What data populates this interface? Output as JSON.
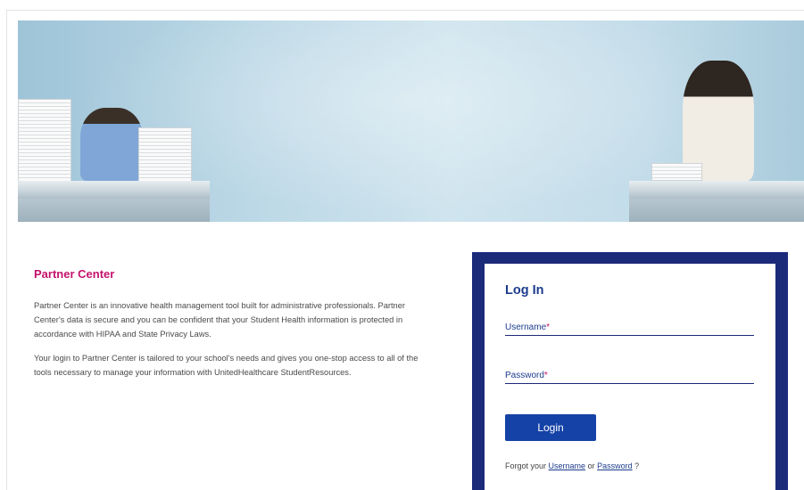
{
  "info": {
    "title": "Partner Center",
    "paragraph1": "Partner Center is an innovative health management tool built for administrative professionals. Partner Center's data is secure and you can be confident that your Student Health information is protected in accordance with HIPAA and State Privacy Laws.",
    "paragraph2": "Your login to Partner Center is tailored to your school's needs and gives you one-stop access to all of the tools necessary to manage your information with UnitedHealthcare StudentResources."
  },
  "login": {
    "title": "Log In",
    "username_label": "Username",
    "password_label": "Password",
    "required_marker": "*",
    "button_label": "Login",
    "forgot_prefix": "Forgot your",
    "forgot_username": "Username",
    "forgot_or": "or",
    "forgot_password": "Password",
    "forgot_suffix": "?"
  },
  "colors": {
    "accent_pink": "#c4126c",
    "navy": "#1c2a7a",
    "button_blue": "#1542a6"
  }
}
